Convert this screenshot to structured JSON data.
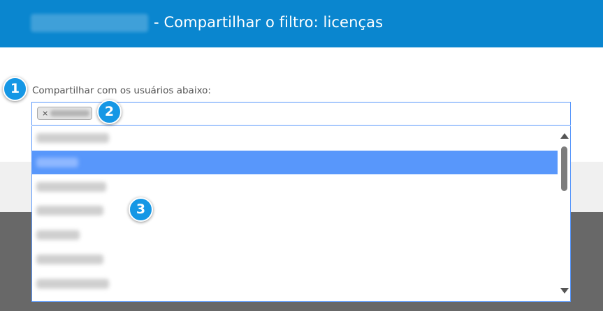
{
  "header": {
    "organization_name": "",
    "title": "- Compartilhar o filtro: licenças",
    "background_color": "#0a86cf"
  },
  "share": {
    "label": "Compartilhar com os usuários abaixo:",
    "selected_users": [
      {
        "remove_label": "×",
        "name": ""
      }
    ]
  },
  "dropdown": {
    "options": [
      "",
      "",
      "",
      "",
      "",
      "",
      ""
    ],
    "highlighted_index": 1,
    "highlight_color": "#5897fb"
  },
  "callouts": {
    "one": "1",
    "two": "2",
    "three": "3"
  }
}
